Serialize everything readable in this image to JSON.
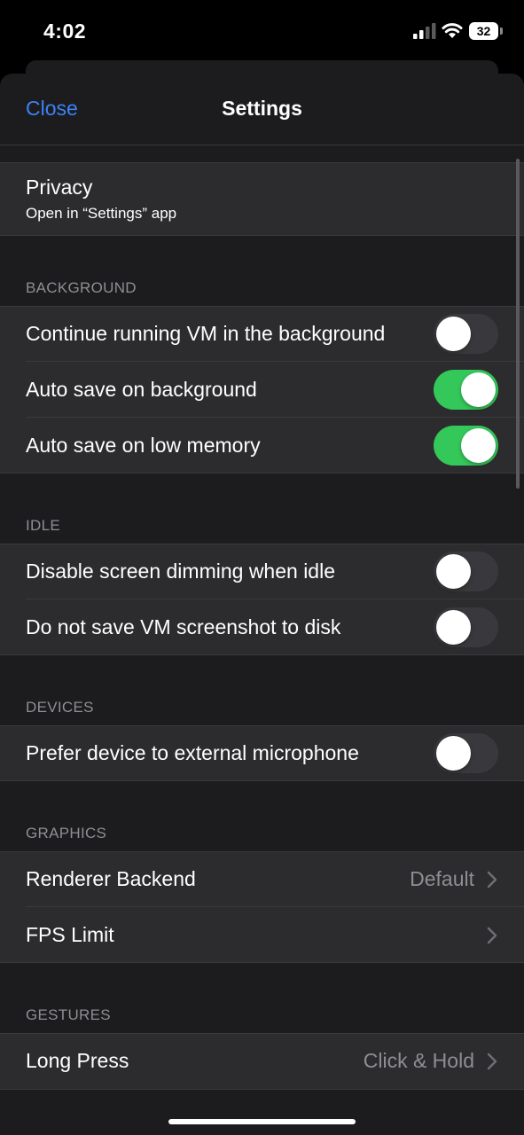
{
  "status_bar": {
    "time": "4:02",
    "battery": "32"
  },
  "nav": {
    "close_label": "Close",
    "title": "Settings"
  },
  "privacy": {
    "title": "Privacy",
    "subtitle": "Open in “Settings” app"
  },
  "sections": {
    "background": {
      "header": "BACKGROUND",
      "items": [
        {
          "label": "Continue running VM in the background",
          "on": false
        },
        {
          "label": "Auto save on background",
          "on": true
        },
        {
          "label": "Auto save on low memory",
          "on": true
        }
      ]
    },
    "idle": {
      "header": "IDLE",
      "items": [
        {
          "label": "Disable screen dimming when idle",
          "on": false
        },
        {
          "label": "Do not save VM screenshot to disk",
          "on": false
        }
      ]
    },
    "devices": {
      "header": "DEVICES",
      "items": [
        {
          "label": "Prefer device to external microphone",
          "on": false
        }
      ]
    },
    "graphics": {
      "header": "GRAPHICS",
      "items": [
        {
          "label": "Renderer Backend",
          "value": "Default"
        },
        {
          "label": "FPS Limit",
          "value": ""
        }
      ]
    },
    "gestures": {
      "header": "GESTURES",
      "items": [
        {
          "label": "Long Press",
          "value": "Click & Hold"
        }
      ]
    }
  },
  "icons": {
    "chevron": "chevron-right-icon",
    "signal": "cellular-signal-icon",
    "wifi": "wifi-icon",
    "battery": "battery-icon"
  },
  "colors": {
    "accent": "#3b82f6",
    "toggle_on": "#34c759",
    "toggle_off": "#39393d"
  }
}
